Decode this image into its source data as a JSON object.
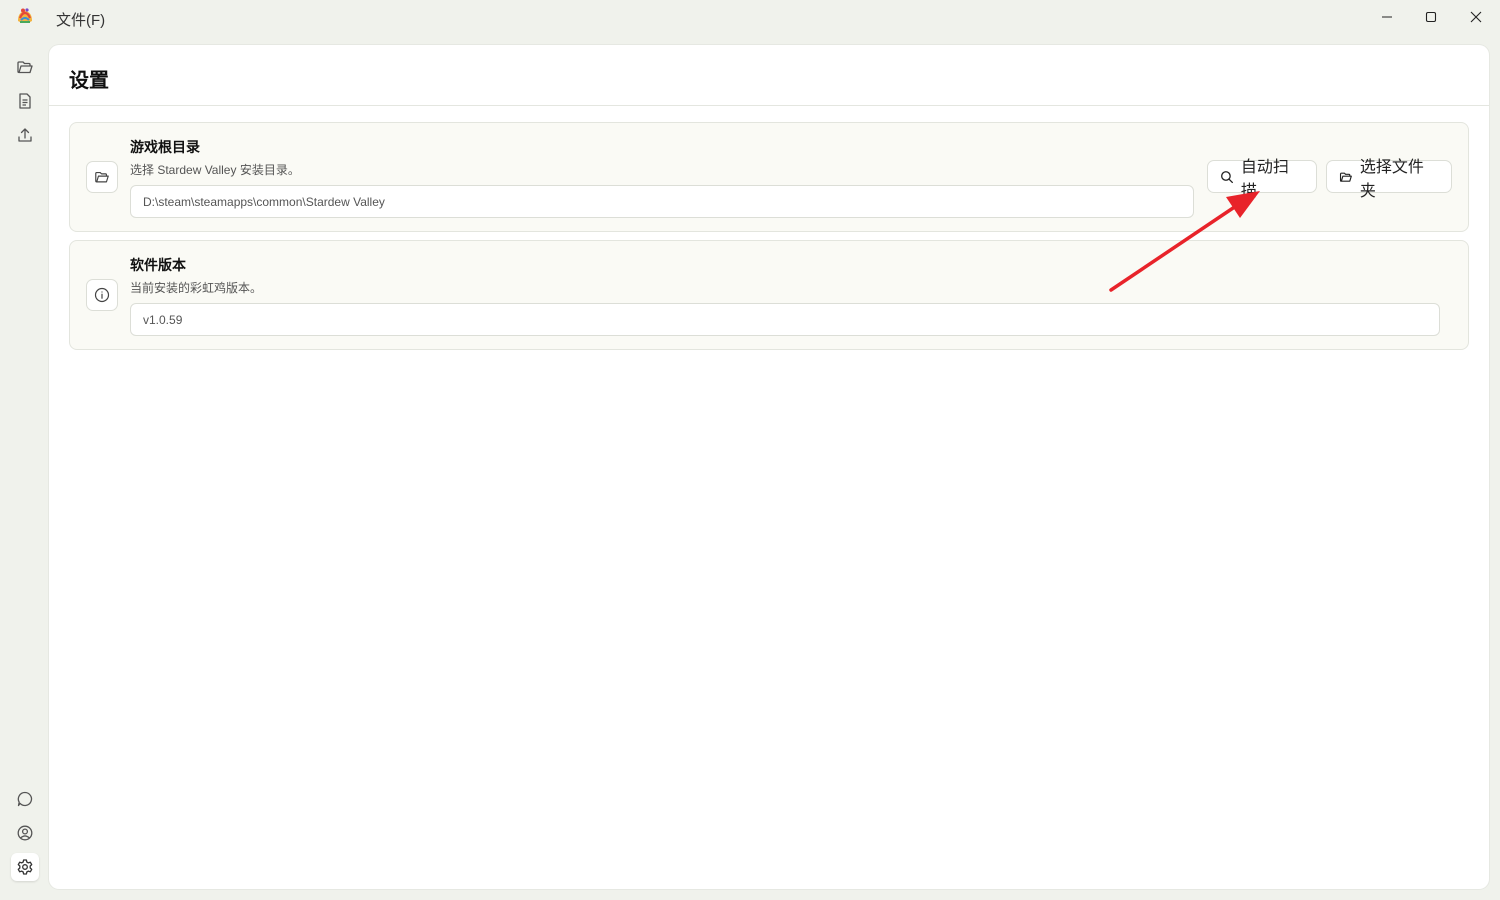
{
  "titlebar": {
    "menu_file": "文件(F)"
  },
  "rail": {
    "top_items": [
      "folder-icon",
      "document-icon",
      "upload-icon"
    ],
    "bottom_items": [
      "chat-icon",
      "user-icon",
      "gear-icon"
    ],
    "active": "gear-icon"
  },
  "page": {
    "title": "设置"
  },
  "settings": {
    "game_dir": {
      "title": "游戏根目录",
      "description": "选择 Stardew Valley 安装目录。",
      "value": "D:\\steam\\steamapps\\common\\Stardew Valley",
      "scan_button": "自动扫描",
      "choose_button": "选择文件夹"
    },
    "version": {
      "title": "软件版本",
      "description": "当前安装的彩虹鸡版本。",
      "value": "v1.0.59"
    }
  },
  "colors": {
    "window_bg": "#f0f2ec",
    "card_bg": "#fafaf5",
    "annotation_arrow": "#e8232a"
  }
}
